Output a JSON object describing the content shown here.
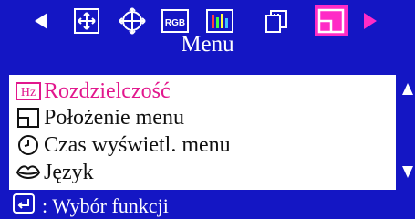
{
  "title": "Menu",
  "toolbar": {
    "icons": [
      "left-arrow-icon",
      "position-icon",
      "geometry-icon",
      "rgb-icon",
      "bars-icon",
      "pages-icon",
      "menu-position-icon",
      "right-arrow-icon"
    ],
    "rgb_label": "RGB",
    "selected_color": "#ff2bc6"
  },
  "menu_items": [
    {
      "label": "Rozdzielczość",
      "icon": "hz-icon",
      "hz_text": "Hz",
      "active": true
    },
    {
      "label": "Położenie menu",
      "icon": "menu-position-icon",
      "active": false
    },
    {
      "label": "Czas wyświetl. menu",
      "icon": "clock-icon",
      "active": false
    },
    {
      "label": "Język",
      "icon": "lips-icon",
      "active": false
    }
  ],
  "footer": {
    "label": ": Wybór funkcji",
    "icon": "enter-icon"
  },
  "colors": {
    "background": "#1416c4",
    "accent": "#e2178d",
    "white": "#ffffff",
    "text": "#111111"
  }
}
